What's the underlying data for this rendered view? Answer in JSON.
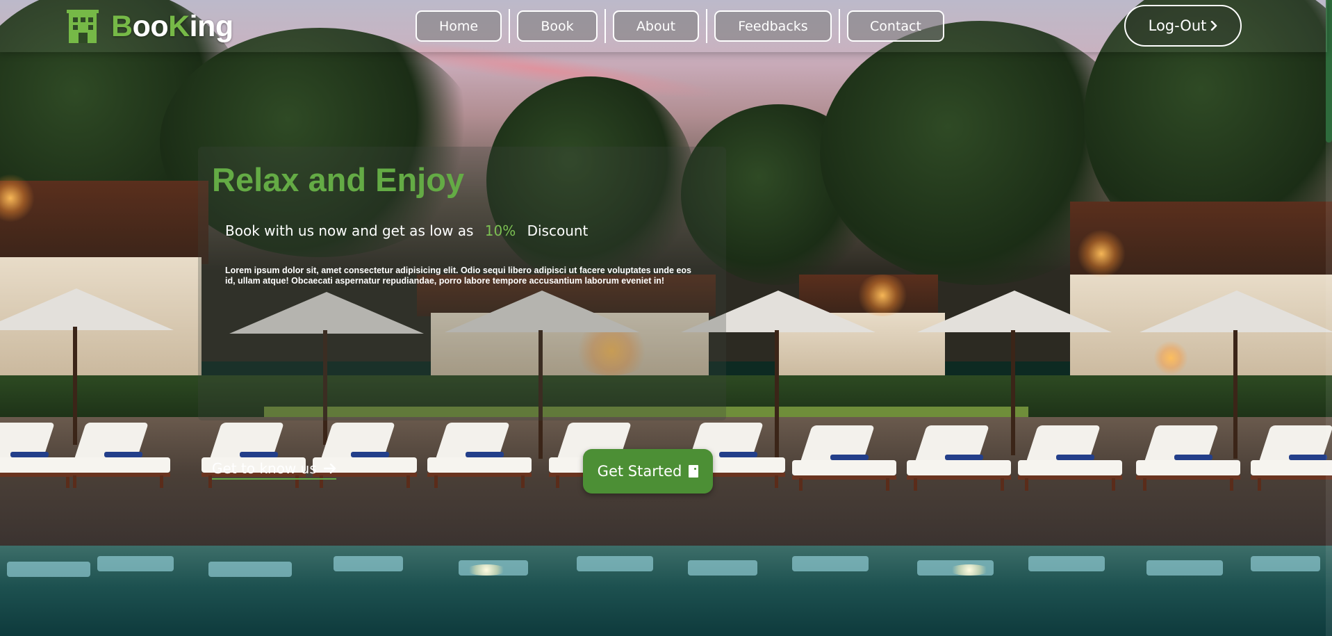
{
  "brand": {
    "logo_part1_accent": "B",
    "logo_part1_rest": "oo",
    "logo_part2_accent": "K",
    "logo_part2_rest": "ing",
    "logo_icon": "hotel-building-icon",
    "accent_color": "#76b947"
  },
  "nav": {
    "items": [
      {
        "label": "Home"
      },
      {
        "label": "Book"
      },
      {
        "label": "About"
      },
      {
        "label": "Feedbacks"
      },
      {
        "label": "Contact"
      }
    ],
    "logout_label": "Log-Out",
    "logout_icon": "chevron-right-icon"
  },
  "hero": {
    "title": "Relax and Enjoy",
    "subtitle_prefix": "Book with us now and get as low as",
    "discount": "10%",
    "subtitle_suffix": "Discount",
    "body": "Lorem ipsum dolor sit, amet consectetur adipisicing elit. Odio sequi libero adipisci ut facere voluptates unde eos id, ullam atque! Obcaecati aspernatur repudiandae, porro labore tempore accusantium laborum eveniet in!",
    "link_label": "Get to know us",
    "link_icon": "arrow-right-icon",
    "cta_label": "Get Started",
    "cta_icon": "document-icon",
    "title_color": "#64ab45",
    "cta_color": "#4c8f35"
  }
}
